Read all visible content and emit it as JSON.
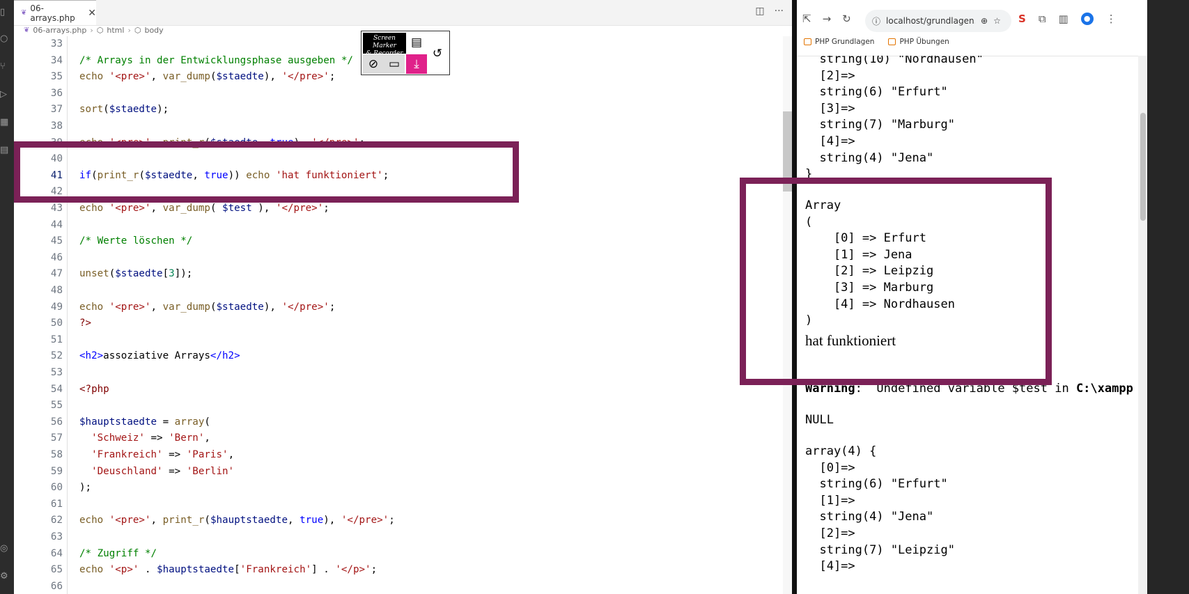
{
  "activity_icons": [
    "files-icon",
    "search-icon",
    "source-control-icon",
    "run-debug-icon",
    "extensions-icon",
    "remote-icon",
    "account-icon",
    "settings-gear-icon"
  ],
  "editor": {
    "tab_label": "06-arrays.php",
    "breadcrumb": [
      "06-arrays.php",
      "html",
      "body"
    ],
    "lines": [
      {
        "n": "33",
        "html": ""
      },
      {
        "n": "34",
        "html": "<span class=\"cm\">/* Arrays in der Entwicklungsphase ausgeben */</span>"
      },
      {
        "n": "35",
        "html": "<span class=\"fn\">echo</span> <span class=\"str\">'&lt;pre&gt;'</span>, <span class=\"fn\">var_dump</span>(<span class=\"var\">$staedte</span>), <span class=\"str\">'&lt;/pre&gt;'</span>;"
      },
      {
        "n": "36",
        "html": ""
      },
      {
        "n": "37",
        "html": "<span class=\"fn\">sort</span>(<span class=\"var\">$staedte</span>);"
      },
      {
        "n": "38",
        "html": ""
      },
      {
        "n": "39",
        "html": "<span class=\"fn\">echo</span> <span class=\"str\">'&lt;pre&gt;'</span>, <span class=\"fn\">print_r</span>(<span class=\"var\">$staedte</span>, <span class=\"kw\">true</span>), <span class=\"str\">'&lt;/pre&gt;'</span>;"
      },
      {
        "n": "40",
        "html": ""
      },
      {
        "n": "41",
        "html": "<span class=\"kw\">if</span>(<span class=\"fn\">print_r</span>(<span class=\"var\">$staedte</span>, <span class=\"kw\">true</span>)) <span class=\"fn\">echo</span> <span class=\"str\">'hat funktioniert'</span>;"
      },
      {
        "n": "42",
        "html": ""
      },
      {
        "n": "43",
        "html": "<span class=\"fn\">echo</span> <span class=\"str\">'&lt;pre&gt;'</span>, <span class=\"fn\">var_dump</span>( <span class=\"var\">$test</span> ), <span class=\"str\">'&lt;/pre&gt;'</span>;"
      },
      {
        "n": "44",
        "html": ""
      },
      {
        "n": "45",
        "html": "<span class=\"cm\">/* Werte löschen */</span>"
      },
      {
        "n": "46",
        "html": ""
      },
      {
        "n": "47",
        "html": "<span class=\"fn\">unset</span>(<span class=\"var\">$staedte</span>[<span class=\"num\">3</span>]);"
      },
      {
        "n": "48",
        "html": ""
      },
      {
        "n": "49",
        "html": "<span class=\"fn\">echo</span> <span class=\"str\">'&lt;pre&gt;'</span>, <span class=\"fn\">var_dump</span>(<span class=\"var\">$staedte</span>), <span class=\"str\">'&lt;/pre&gt;'</span>;"
      },
      {
        "n": "50",
        "html": "<span class=\"tag\">?&gt;</span>"
      },
      {
        "n": "51",
        "html": ""
      },
      {
        "n": "52",
        "html": "<span class=\"kw\">&lt;h2&gt;</span>assoziative Arrays<span class=\"kw\">&lt;/h2&gt;</span>"
      },
      {
        "n": "53",
        "html": ""
      },
      {
        "n": "54",
        "html": "<span class=\"tag\">&lt;?php</span>"
      },
      {
        "n": "55",
        "html": ""
      },
      {
        "n": "56",
        "html": "<span class=\"var\">$hauptstaedte</span> = <span class=\"fn\">array</span>("
      },
      {
        "n": "57",
        "html": "  <span class=\"str\">'Schweiz'</span> =&gt; <span class=\"str\">'Bern'</span>,"
      },
      {
        "n": "58",
        "html": "  <span class=\"str\">'Frankreich'</span> =&gt; <span class=\"str\">'Paris'</span>,"
      },
      {
        "n": "59",
        "html": "  <span class=\"str\">'Deuschland'</span> =&gt; <span class=\"str\">'Berlin'</span>"
      },
      {
        "n": "60",
        "html": ");"
      },
      {
        "n": "61",
        "html": ""
      },
      {
        "n": "62",
        "html": "<span class=\"fn\">echo</span> <span class=\"str\">'&lt;pre&gt;'</span>, <span class=\"fn\">print_r</span>(<span class=\"var\">$hauptstaedte</span>, <span class=\"kw\">true</span>), <span class=\"str\">'&lt;/pre&gt;'</span>;"
      },
      {
        "n": "63",
        "html": ""
      },
      {
        "n": "64",
        "html": "<span class=\"cm\">/* Zugriff */</span>"
      },
      {
        "n": "65",
        "html": "<span class=\"fn\">echo</span> <span class=\"str\">'&lt;p&gt;'</span> . <span class=\"var\">$hauptstaedte</span>[<span class=\"str\">'Frankreich'</span>] . <span class=\"str\">'&lt;/p&gt;'</span>;"
      },
      {
        "n": "66",
        "html": ""
      }
    ],
    "current_line": "41"
  },
  "screen_marker": {
    "logo_line1": "Screen Marker",
    "logo_line2": "& Recorder"
  },
  "browser": {
    "url": "localhost/grundlagen...",
    "bookmarks": [
      "PHP Grundlagen",
      "PHP Übungen"
    ],
    "output": [
      {
        "t": "mono",
        "text": "  string(10) \"Nordhausen\""
      },
      {
        "t": "mono",
        "text": "  [2]=>"
      },
      {
        "t": "mono",
        "text": "  string(6) \"Erfurt\""
      },
      {
        "t": "mono",
        "text": "  [3]=>"
      },
      {
        "t": "mono",
        "text": "  string(7) \"Marburg\""
      },
      {
        "t": "mono",
        "text": "  [4]=>"
      },
      {
        "t": "mono",
        "text": "  string(4) \"Jena\""
      },
      {
        "t": "mono",
        "text": "}"
      },
      {
        "t": "gap"
      },
      {
        "t": "mono",
        "text": "Array"
      },
      {
        "t": "mono",
        "text": "("
      },
      {
        "t": "mono",
        "text": "    [0] => Erfurt"
      },
      {
        "t": "mono",
        "text": "    [1] => Jena"
      },
      {
        "t": "mono",
        "text": "    [2] => Leipzig"
      },
      {
        "t": "mono",
        "text": "    [3] => Marburg"
      },
      {
        "t": "mono",
        "text": "    [4] => Nordhausen"
      },
      {
        "t": "mono",
        "text": ")"
      },
      {
        "t": "serif",
        "text": "hat funktioniert"
      },
      {
        "t": "gap"
      },
      {
        "t": "gap"
      },
      {
        "t": "warn",
        "label": "Warning",
        "text": ":  Undefined variable $test in ",
        "path": "C:\\xampp"
      },
      {
        "t": "gap"
      },
      {
        "t": "mono",
        "text": "NULL"
      },
      {
        "t": "gap"
      },
      {
        "t": "mono",
        "text": "array(4) {"
      },
      {
        "t": "mono",
        "text": "  [0]=>"
      },
      {
        "t": "mono",
        "text": "  string(6) \"Erfurt\""
      },
      {
        "t": "mono",
        "text": "  [1]=>"
      },
      {
        "t": "mono",
        "text": "  string(4) \"Jena\""
      },
      {
        "t": "mono",
        "text": "  [2]=>"
      },
      {
        "t": "mono",
        "text": "  string(7) \"Leipzig\""
      },
      {
        "t": "mono",
        "text": "  [4]=>"
      }
    ]
  },
  "colors": {
    "highlight": "#7b2157",
    "editor_bg": "#ffffff",
    "dark_chrome": "#262626"
  }
}
